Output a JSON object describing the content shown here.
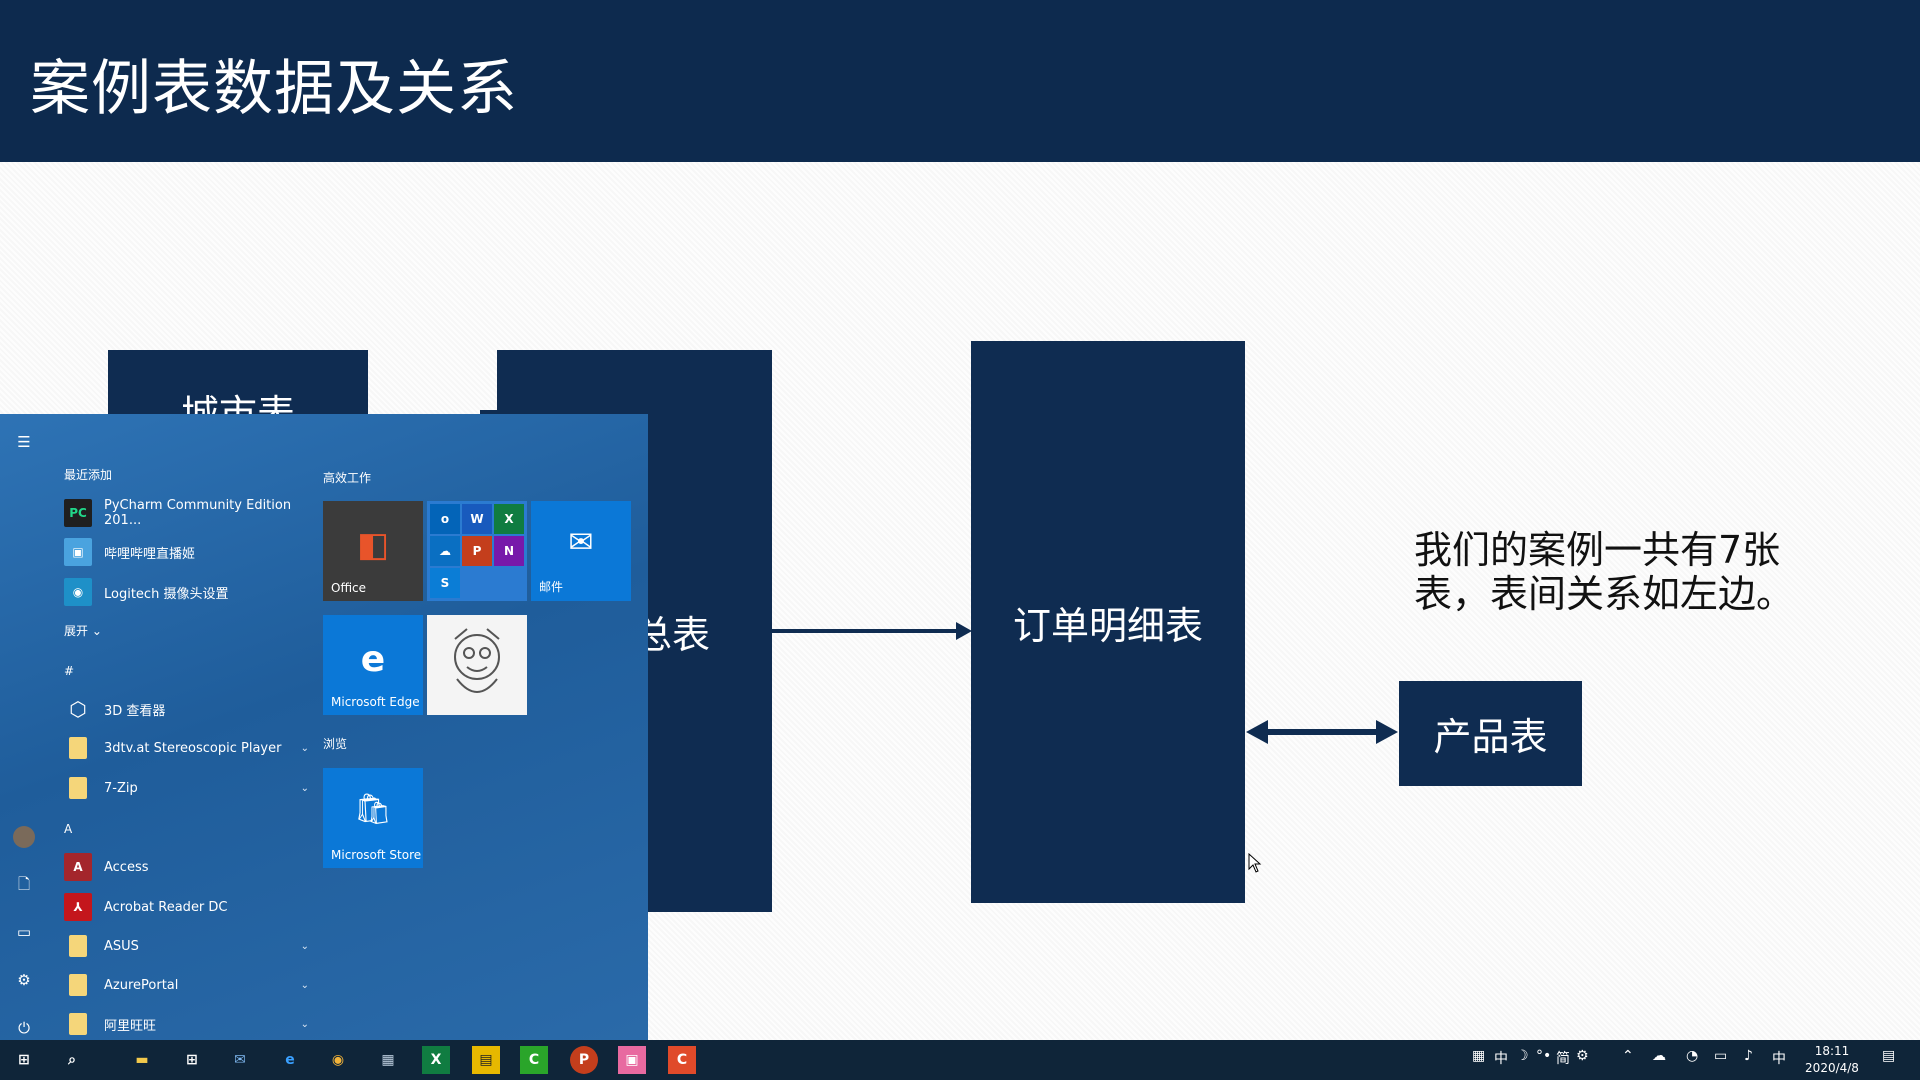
{
  "slide": {
    "title": "案例表数据及关系",
    "box_city": "城市表",
    "box_order_total": "总表",
    "box_order_detail": "订单明细表",
    "box_product": "产品表",
    "note": "我们的案例一共有7张表，表间关系如左边。",
    "colors": {
      "banner": "#0d2a4e",
      "box": "#0f2c51"
    }
  },
  "start_menu": {
    "recent_header": "最近添加",
    "recent": [
      {
        "label": "PyCharm Community Edition 201...",
        "icon": "pycharm-icon"
      },
      {
        "label": "哔哩哔哩直播姬",
        "icon": "bilibili-live-icon"
      },
      {
        "label": "Logitech 摄像头设置",
        "icon": "logitech-camera-icon"
      }
    ],
    "expand": "展开",
    "hash_header": "#",
    "apps_hash": [
      {
        "label": "3D 查看器",
        "icon": "cube-icon"
      },
      {
        "label": "3dtv.at Stereoscopic Player",
        "icon": "folder-icon"
      },
      {
        "label": "7-Zip",
        "icon": "folder-icon"
      }
    ],
    "a_header": "A",
    "apps_a": [
      {
        "label": "Access",
        "icon": "access-icon"
      },
      {
        "label": "Acrobat Reader DC",
        "icon": "acrobat-icon"
      },
      {
        "label": "ASUS",
        "icon": "folder-icon"
      },
      {
        "label": "AzurePortal",
        "icon": "folder-icon"
      },
      {
        "label": "阿里旺旺",
        "icon": "folder-icon"
      }
    ],
    "tiles_header_work": "高效工作",
    "tiles_header_browse": "浏览",
    "tile_office": "Office",
    "tile_mail": "邮件",
    "tile_edge": "Microsoft Edge",
    "tile_store": "Microsoft Store"
  },
  "taskbar": {
    "ime": "中",
    "ime_mode": "简",
    "lang": "中",
    "time": "18:11",
    "date": "2020/4/8"
  }
}
